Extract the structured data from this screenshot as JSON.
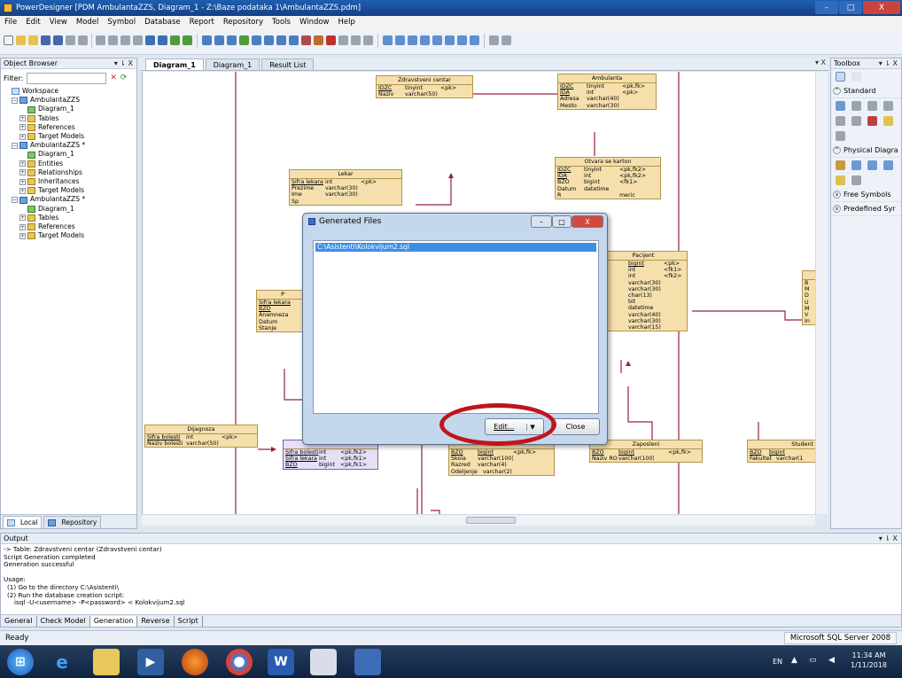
{
  "window": {
    "title": "PowerDesigner [PDM AmbulantaZZS, Diagram_1 - Z:\\Baze podataka 1\\AmbulantaZZS.pdm]",
    "min": "–",
    "max": "□",
    "close": "X"
  },
  "menu": [
    "File",
    "Edit",
    "View",
    "Model",
    "Symbol",
    "Database",
    "Report",
    "Repository",
    "Tools",
    "Window",
    "Help"
  ],
  "browser": {
    "title": "Object Browser",
    "pin": "▾ ⇂ X",
    "filter_label": "Filter:",
    "tree": [
      {
        "label": "Workspace",
        "depth": 0,
        "icon": "ws"
      },
      {
        "label": "AmbulantaZZS",
        "depth": 1,
        "icon": "mdl"
      },
      {
        "label": "Diagram_1",
        "depth": 2,
        "icon": "dgm"
      },
      {
        "label": "Tables",
        "depth": 2,
        "icon": "fold"
      },
      {
        "label": "References",
        "depth": 2,
        "icon": "fold"
      },
      {
        "label": "Target Models",
        "depth": 2,
        "icon": "fold"
      },
      {
        "label": "AmbulantaZZS *",
        "depth": 1,
        "icon": "mdl"
      },
      {
        "label": "Diagram_1",
        "depth": 2,
        "icon": "dgm"
      },
      {
        "label": "Entities",
        "depth": 2,
        "icon": "fold"
      },
      {
        "label": "Relationships",
        "depth": 2,
        "icon": "fold"
      },
      {
        "label": "Inheritances",
        "depth": 2,
        "icon": "fold"
      },
      {
        "label": "Target Models",
        "depth": 2,
        "icon": "fold"
      },
      {
        "label": "AmbulantaZZS *",
        "depth": 1,
        "icon": "mdl"
      },
      {
        "label": "Diagram_1",
        "depth": 2,
        "icon": "dgm"
      },
      {
        "label": "Tables",
        "depth": 2,
        "icon": "fold"
      },
      {
        "label": "References",
        "depth": 2,
        "icon": "fold"
      },
      {
        "label": "Target Models",
        "depth": 2,
        "icon": "fold"
      }
    ],
    "tab_local": "Local",
    "tab_repo": "Repository"
  },
  "doc_tabs": [
    "Diagram_1",
    "Diagram_1",
    "Result List"
  ],
  "doc_close": "▾ X",
  "entities": {
    "zc": {
      "name": "Zdravstveni centar",
      "rows": [
        [
          "IDZC",
          "tinyint",
          "<pk>"
        ],
        [
          "Naziv",
          "varchar(50)",
          ""
        ]
      ]
    },
    "amb": {
      "name": "Ambulanta",
      "rows": [
        [
          "IDZC",
          "tinyint",
          "<pk,fk>"
        ],
        [
          "IDA",
          "int",
          "<pk>"
        ],
        [
          "Adresa",
          "varchar(40)",
          ""
        ],
        [
          "Mesto",
          "varchar(30)",
          ""
        ]
      ]
    },
    "lek": {
      "name": "Lekar",
      "rows": [
        [
          "Sifra lekara",
          "int",
          "<pk>"
        ],
        [
          "Prezime",
          "varchar(30)",
          ""
        ],
        [
          "Ime",
          "varchar(30)",
          ""
        ],
        [
          "Sp",
          "",
          ""
        ]
      ]
    },
    "ok": {
      "name": "Otvara se karton",
      "rows": [
        [
          "IDZC",
          "tinyint",
          "<pk,fk2>"
        ],
        [
          "IDA",
          "int",
          "<pk,fk2>"
        ],
        [
          "BZO",
          "bigint",
          "<fk1>"
        ],
        [
          "Datum",
          "datetime",
          ""
        ],
        [
          "R",
          "",
          "meric"
        ]
      ]
    },
    "pac": {
      "name": "Pacijent",
      "rows": [
        [
          "",
          "bigint",
          "<pk>"
        ],
        [
          "",
          "int",
          "<fk1>"
        ],
        [
          "",
          "int",
          "<fk2>"
        ],
        [
          "",
          "varchar(30)",
          ""
        ],
        [
          "",
          "varchar(30)",
          ""
        ],
        [
          "",
          "char(13)",
          ""
        ],
        [
          "",
          "bit",
          ""
        ],
        [
          "a",
          "datetime",
          ""
        ],
        [
          "a",
          "varchar(40)",
          ""
        ],
        [
          "a",
          "varchar(30)",
          ""
        ],
        [
          "",
          "varchar(15)",
          ""
        ]
      ]
    },
    "pr": {
      "name": "P",
      "rows": [
        [
          "Sifra lekara",
          "",
          ""
        ],
        [
          "BZO",
          "",
          ""
        ],
        [
          "Anamneza",
          "",
          ""
        ],
        [
          "Datum",
          "",
          ""
        ],
        [
          "Stanje",
          "",
          ""
        ]
      ]
    },
    "dij": {
      "name": "Dijagnoza",
      "rows": [
        [
          "Sifra bolesti",
          "int",
          "<pk>"
        ],
        [
          "Naziv bolesti",
          "varchar(50)",
          ""
        ]
      ]
    },
    "dg": {
      "name": "",
      "rows": [
        [
          "Sifra bolesti",
          "int",
          "<pk,fk2>"
        ],
        [
          "Sifra lekara",
          "int",
          "<pk,fk1>"
        ],
        [
          "BZO",
          "bigint",
          "<pk,fk1>"
        ]
      ]
    },
    "uc": {
      "name": "",
      "rows": [
        [
          "BZO",
          "bigint",
          "<pk,fk>"
        ],
        [
          "Skola",
          "varchar(100)",
          ""
        ],
        [
          "Razred",
          "varchar(4)",
          ""
        ],
        [
          "Odeljenje",
          "varchar(2)",
          ""
        ]
      ]
    },
    "zap": {
      "name": "Zaposleni",
      "rows": [
        [
          "BZO",
          "bigint",
          "<pk,fk>"
        ],
        [
          "Naziv RO",
          "varchar(100)",
          ""
        ]
      ]
    },
    "stu": {
      "name": "Student",
      "rows": [
        [
          "BZO",
          "bigint",
          ""
        ],
        [
          "Fakultet",
          "varchar(1",
          ""
        ]
      ]
    },
    "right": {
      "name": "",
      "rows": [
        [
          "B",
          "",
          ""
        ],
        [
          "M",
          "",
          ""
        ],
        [
          "D",
          "",
          ""
        ],
        [
          "U",
          "",
          ""
        ],
        [
          "M",
          "",
          ""
        ],
        [
          "V",
          "",
          ""
        ],
        [
          "In",
          "",
          ""
        ]
      ]
    }
  },
  "toolbox": {
    "title": "Toolbox",
    "pin": "▾ ⇂ X",
    "standard": "Standard",
    "physical": "Physical Diagra",
    "free": "Free Symbols",
    "predefined": "Predefined Syr"
  },
  "dialog": {
    "title": "Generated Files",
    "file": "C:\\Asistenti\\Kolokvijum2.sql",
    "edit": "Edit...",
    "close": "Close",
    "min": "–",
    "max": "□",
    "x": "X"
  },
  "output": {
    "title": "Output",
    "pin": "▾ ⇂ X",
    "lines": [
      "-> Table: Zdravstveni centar (Zdravstveni centar)",
      "Script Generation completed",
      "Generation successful",
      "",
      "Usage:",
      "(1) Go to the directory C:\\Asistenti\\",
      "(2) Run the database creation script:",
      "isql -U<username> -P<password> < Kolokvijum2.sql"
    ],
    "tabs": [
      "General",
      "Check Model",
      "Generation",
      "Reverse",
      "Script"
    ]
  },
  "status": {
    "left": "Ready",
    "dbms": "Microsoft SQL Server 2008"
  },
  "tray": {
    "lang": "EN",
    "time": "11:34 AM",
    "date": "1/11/2018"
  }
}
